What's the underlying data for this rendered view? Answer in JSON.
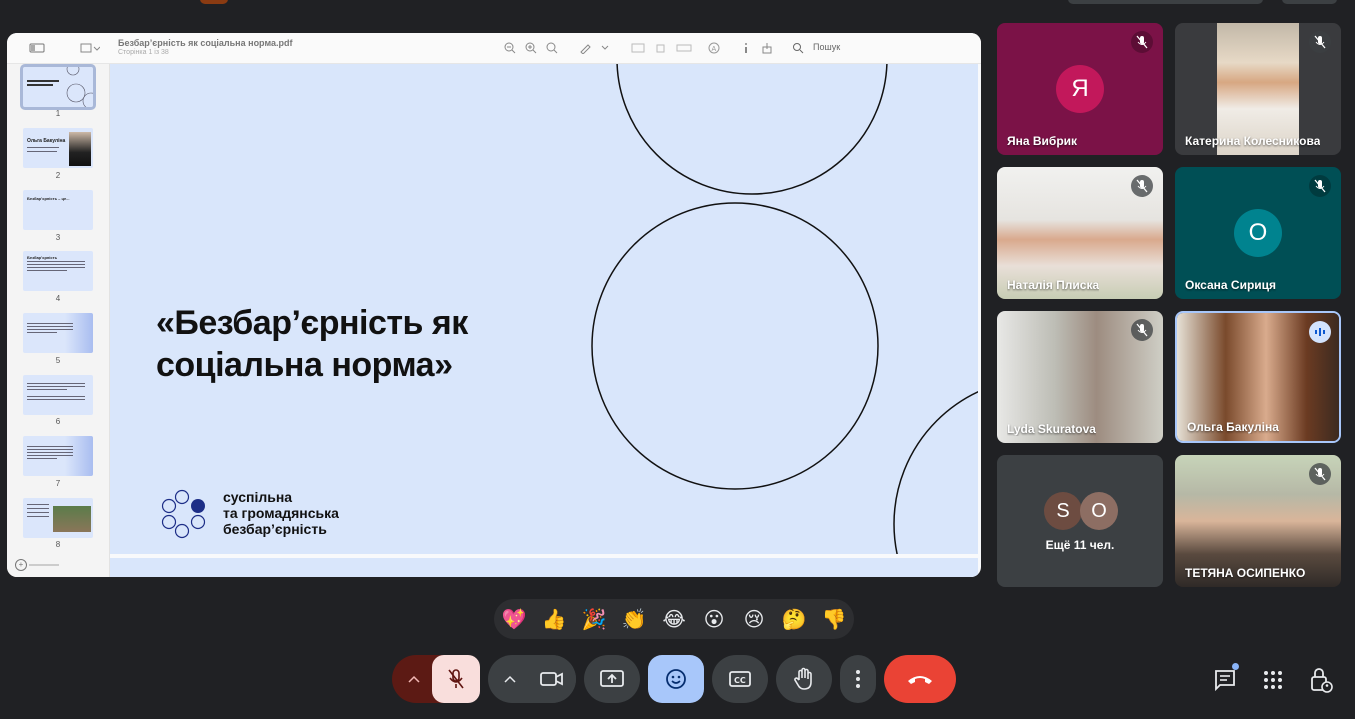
{
  "pdf": {
    "filename": "Безбар’єрність як соціальна норма.pdf",
    "page_info": "Сторінка 1 із 38",
    "search_label": "Пошук",
    "thumbnails": [
      {
        "num": "1",
        "title": "«Безбар’єрність як соціальна норма»"
      },
      {
        "num": "2",
        "title": "Ольга Бакуліна"
      },
      {
        "num": "3",
        "title": "Безбар’єрність – це..."
      },
      {
        "num": "4",
        "title": "Безбар’єрність"
      },
      {
        "num": "5",
        "title": ""
      },
      {
        "num": "6",
        "title": ""
      },
      {
        "num": "7",
        "title": ""
      },
      {
        "num": "8",
        "title": ""
      }
    ],
    "slide": {
      "title_line1": "«Безбар’єрність як",
      "title_line2": "соціальна норма»",
      "brand_line1": "суспільна",
      "brand_line2": "та громадянська",
      "brand_line3": "безбар’єрність"
    }
  },
  "participants": [
    {
      "name": "Яна Вибрик",
      "initial": "Я",
      "avatar_color": "#c2185b",
      "muted": true
    },
    {
      "name": "Катерина Колесникова",
      "muted": true
    },
    {
      "name": "Наталія Плиска",
      "muted": true
    },
    {
      "name": "Оксана Сириця",
      "initial": "О",
      "avatar_color": "#00838f",
      "muted": true
    },
    {
      "name": "Lyda Skuratova",
      "muted": true
    },
    {
      "name": "Ольга Бакуліна",
      "muted": false,
      "speaking": true
    },
    {
      "name": "Ещё 11 чел.",
      "initials": [
        "S",
        "O"
      ],
      "avatar_color": "#6d4c41"
    },
    {
      "name": "ТЕТЯНА ОСИПЕНКО",
      "muted": true
    }
  ],
  "reactions": [
    "💖",
    "👍",
    "🎉",
    "👏",
    "😂",
    "😮",
    "😢",
    "🤔",
    "👎"
  ],
  "colors": {
    "background": "#202124",
    "end_call": "#ea4335",
    "mic_off_bg": "#f9dedc",
    "reactions_active": "#a8c7fa"
  }
}
